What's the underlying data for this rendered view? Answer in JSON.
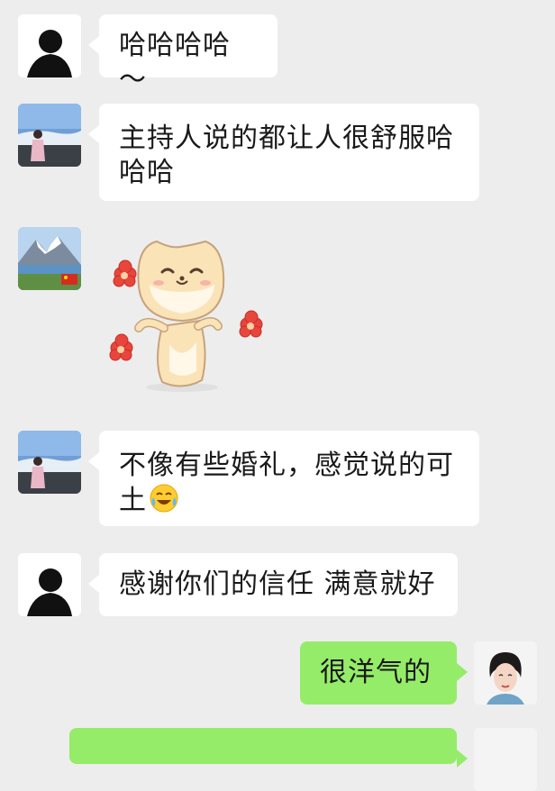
{
  "messages": [
    {
      "side": "left",
      "avatar": "man-silhouette-avatar",
      "text": "哈哈哈哈～"
    },
    {
      "side": "left",
      "avatar": "traveler-photo-avatar",
      "text": "主持人说的都让人很舒服哈哈哈"
    },
    {
      "side": "left",
      "avatar": "mountain-lake-avatar",
      "sticker": "cat-dancing-with-flowers-sticker"
    },
    {
      "side": "left",
      "avatar": "traveler-photo-avatar",
      "text": "不像有些婚礼，感觉说的可土",
      "emoji": "laughing-crying-emoji"
    },
    {
      "side": "left",
      "avatar": "man-silhouette-avatar",
      "text": "感谢你们的信任 满意就好"
    },
    {
      "side": "right",
      "avatar": "woman-portrait-avatar",
      "text": "很洋气的"
    }
  ],
  "colors": {
    "background": "#ededed",
    "incoming_bubble": "#ffffff",
    "outgoing_bubble": "#95ec69"
  }
}
